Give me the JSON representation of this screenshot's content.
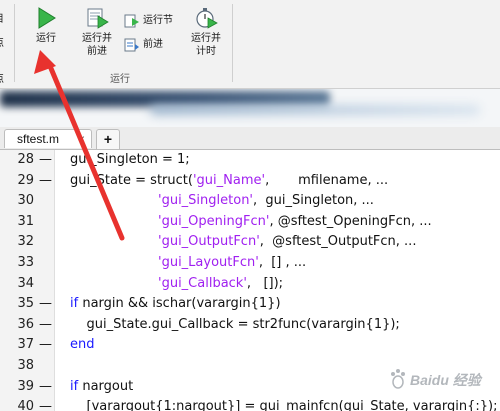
{
  "toolbar": {
    "left_stub_top": "目",
    "left_stub_mid": "点",
    "left_stub_bottom": "点",
    "run_label": "运行",
    "run_advance_label_line1": "运行并",
    "run_advance_label_line2": "前进",
    "run_section_label": "运行节",
    "advance_label": "前进",
    "run_time_label_line1": "运行并",
    "run_time_label_line2": "计时",
    "group_label": "运行"
  },
  "tabs": {
    "file_tab": "sftest.m",
    "close_glyph": "×",
    "add_glyph": "+"
  },
  "editor": {
    "lines": [
      {
        "n": "28",
        "dash": "—",
        "parts": [
          "gui_Singleton = 1;"
        ]
      },
      {
        "n": "29",
        "dash": "—",
        "parts": [
          "gui_State = struct(",
          "'gui_Name'",
          ",       mfilename, ..."
        ]
      },
      {
        "n": "30",
        "dash": "",
        "parts": [
          "",
          "'gui_Singleton'",
          ",  gui_Singleton, ..."
        ]
      },
      {
        "n": "31",
        "dash": "",
        "parts": [
          "",
          "'gui_OpeningFcn'",
          ", @sftest_OpeningFcn, ..."
        ]
      },
      {
        "n": "32",
        "dash": "",
        "parts": [
          "",
          "'gui_OutputFcn'",
          ",  @sftest_OutputFcn, ..."
        ]
      },
      {
        "n": "33",
        "dash": "",
        "parts": [
          "",
          "'gui_LayoutFcn'",
          ",  [] , ..."
        ]
      },
      {
        "n": "34",
        "dash": "",
        "parts": [
          "",
          "'gui_Callback'",
          ",   []);"
        ]
      },
      {
        "n": "35",
        "dash": "—",
        "parts": [
          "if",
          " nargin && ischar(varargin{1})"
        ]
      },
      {
        "n": "36",
        "dash": "—",
        "parts": [
          "    gui_State.gui_Callback = str2func(varargin{1});"
        ]
      },
      {
        "n": "37",
        "dash": "—",
        "parts": [
          "end"
        ]
      },
      {
        "n": "38",
        "dash": "",
        "parts": [
          ""
        ]
      },
      {
        "n": "39",
        "dash": "—",
        "parts": [
          "if",
          " nargout"
        ]
      },
      {
        "n": "40",
        "dash": "—",
        "parts": [
          "    [varargout{1:nargout}] = gui_mainfcn(gui_State, varargin{:});"
        ]
      }
    ]
  },
  "watermark": {
    "text": "Baidu 经验"
  },
  "colors": {
    "keyword": "#1a1aff",
    "string": "#a020f0",
    "arrow": "#e8322e",
    "run_icon": "#2e9e3e"
  }
}
